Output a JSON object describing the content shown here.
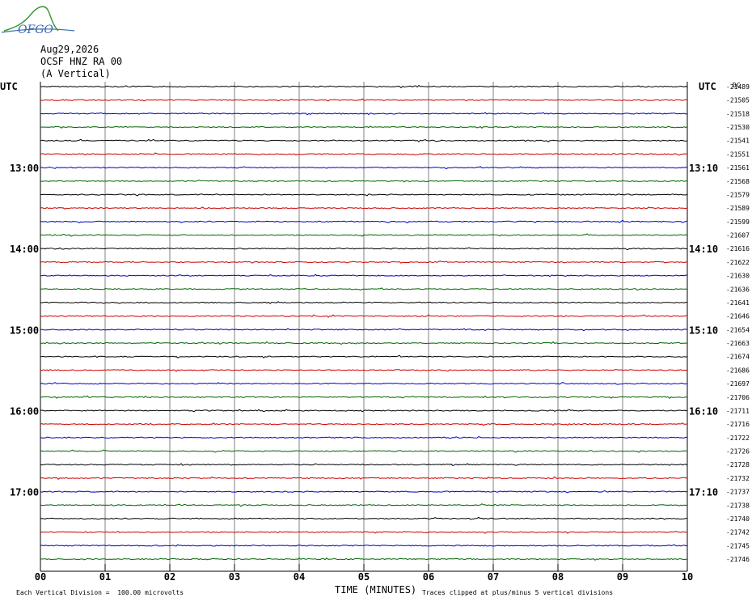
{
  "header": {
    "logo_text": "OFGO",
    "date": "Aug29,2026",
    "station": "OCSF HNZ RA 00",
    "channel_desc": "(A Vertical)",
    "left_tz": "UTC",
    "right_tz": "UTC",
    "dc_label": "DC"
  },
  "footer": {
    "scale_note": "Each Vertical Division =  100.00 microvolts",
    "xlabel": "TIME (MINUTES)",
    "clip_note": "Traces clipped at plus/minus 5 vertical divisions"
  },
  "colors": {
    "trace_cycle": [
      "#000000",
      "#cc0000",
      "#0000cc",
      "#006600"
    ],
    "grid": "#808080",
    "logo_green": "#3a9a3a",
    "logo_blue": "#3a6ab0"
  },
  "chart_data": {
    "type": "line",
    "xlabel": "TIME (MINUTES)",
    "xlim": [
      0,
      10
    ],
    "x_ticks": [
      "00",
      "01",
      "02",
      "03",
      "04",
      "05",
      "06",
      "07",
      "08",
      "09",
      "10"
    ],
    "row_minutes": 10,
    "num_rows": 36,
    "left_hour_labels": [
      {
        "row": 6,
        "label": "13:00"
      },
      {
        "row": 12,
        "label": "14:00"
      },
      {
        "row": 18,
        "label": "15:00"
      },
      {
        "row": 24,
        "label": "16:00"
      },
      {
        "row": 30,
        "label": "17:00"
      }
    ],
    "right_hour_labels": [
      {
        "row": 6,
        "label": "13:10"
      },
      {
        "row": 12,
        "label": "14:10"
      },
      {
        "row": 18,
        "label": "15:10"
      },
      {
        "row": 24,
        "label": "16:10"
      },
      {
        "row": 30,
        "label": "17:10"
      }
    ],
    "dc_offsets": [
      "-21489",
      "-21505",
      "-21518",
      "-21530",
      "-21541",
      "-21551",
      "-21561",
      "-21568",
      "-21579",
      "-21589",
      "-21599",
      "-21607",
      "-21616",
      "-21622",
      "-21630",
      "-21636",
      "-21641",
      "-21646",
      "-21654",
      "-21663",
      "-21674",
      "-21686",
      "-21697",
      "-21706",
      "-21711",
      "-21716",
      "-21722",
      "-21726",
      "-21728",
      "-21732",
      "-21737",
      "-21738",
      "-21740",
      "-21742",
      "-21745",
      "-21746"
    ],
    "grid": true
  }
}
